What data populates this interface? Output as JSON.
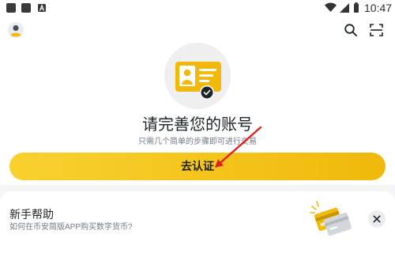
{
  "status_bar": {
    "time": "10:47",
    "left_icons": [
      "app-square-icon",
      "app-square-icon",
      "letter-a-icon"
    ],
    "right_icons": [
      "wifi-icon",
      "signal-icon",
      "battery-icon"
    ]
  },
  "header": {
    "left_icon": "avatar-icon",
    "right_icons": [
      "search-icon",
      "scan-icon"
    ]
  },
  "verification": {
    "illustration": "id-card-check-illustration",
    "title": "请完善您的账号",
    "subtitle": "只需几个简单的步骤即可进行交易",
    "button_label": "去认证"
  },
  "help_card": {
    "title": "新手帮助",
    "subtitle": "如何在币安简版APP购买数字货币?",
    "illustration": "bank-cards-illustration",
    "close_icon": "close-icon"
  },
  "annotation": {
    "icon": "red-arrow-annotation",
    "color": "#e02020"
  },
  "colors": {
    "accent": "#f0b90b",
    "accent_light": "#f8d12f",
    "text_primary": "#1e2329",
    "text_secondary": "#707a8a",
    "background_gray": "#f5f5f5"
  }
}
